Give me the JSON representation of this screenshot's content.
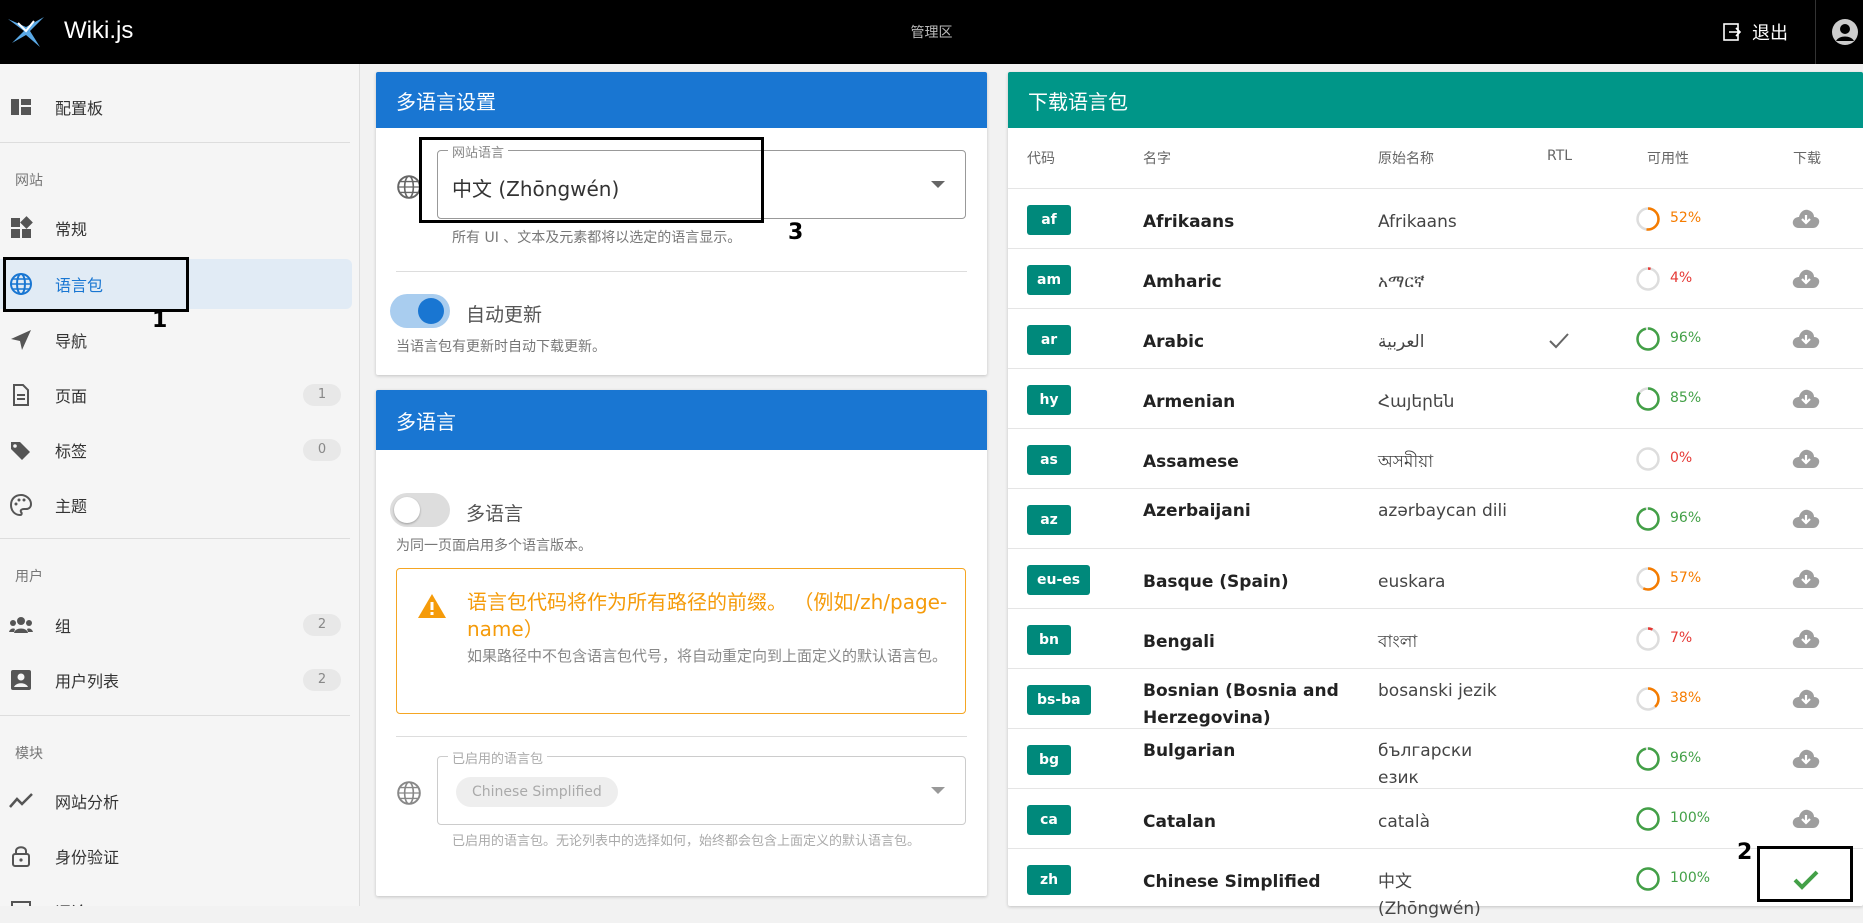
{
  "header": {
    "title": "Wiki.js",
    "center": "管理区",
    "logout": "退出"
  },
  "sidebar": {
    "dashboard": "配置板",
    "section_site": "网站",
    "general": "常规",
    "locale": "语言包",
    "navigation": "导航",
    "pages": "页面",
    "pages_count": "1",
    "tags": "标签",
    "tags_count": "0",
    "theme": "主题",
    "section_users": "用户",
    "groups": "组",
    "groups_count": "2",
    "users": "用户列表",
    "users_count": "2",
    "section_modules": "模块",
    "analytics": "网站分析",
    "auth": "身份验证",
    "comments": "评论"
  },
  "locale_panel": {
    "title": "多语言设置",
    "site_locale_label": "网站语言",
    "site_locale_value": "中文 (Zhōngwén)",
    "site_locale_hint": "所有 UI 、文本及元素都将以选定的语言显示。",
    "auto_update_label": "自动更新",
    "auto_update_hint": "当语言包有更新时自动下载更新。"
  },
  "namespace_panel": {
    "title": "多语言",
    "toggle_label": "多语言",
    "toggle_hint": "为同一页面启用多个语言版本。",
    "warning_title": "语言包代码将作为所有路径的前缀。 （例如/zh/page-name）",
    "warning_sub": "如果路径中不包含语言包代号，将自动重定向到上面定义的默认语言包。",
    "enabled_label": "已启用的语言包",
    "enabled_chip": "Chinese Simplified",
    "enabled_hint": "已启用的语言包。无论列表中的选择如何，始终都会包含上面定义的默认语言包。"
  },
  "download_panel": {
    "title": "下载语言包",
    "columns": {
      "code": "代码",
      "name": "名字",
      "native": "原始名称",
      "rtl": "RTL",
      "availability": "可用性",
      "download": "下载"
    },
    "rows": [
      {
        "code": "af",
        "name": "Afrikaans",
        "native": "Afrikaans",
        "rtl": false,
        "pct": "52%",
        "value": 52,
        "color": "#f57c00",
        "installed": false
      },
      {
        "code": "am",
        "name": "Amharic",
        "native": "አማርኛ",
        "rtl": false,
        "pct": "4%",
        "value": 4,
        "color": "#e53935",
        "installed": false
      },
      {
        "code": "ar",
        "name": "Arabic",
        "native": "العربية",
        "rtl": true,
        "pct": "96%",
        "value": 96,
        "color": "#43a047",
        "installed": false
      },
      {
        "code": "hy",
        "name": "Armenian",
        "native": "Հայերեն",
        "rtl": false,
        "pct": "85%",
        "value": 85,
        "color": "#43a047",
        "installed": false
      },
      {
        "code": "as",
        "name": "Assamese",
        "native": "অসমীয়া",
        "rtl": false,
        "pct": "0%",
        "value": 0,
        "color": "#e53935",
        "installed": false
      },
      {
        "code": "az",
        "name": "Azerbaijani",
        "native": "azərbaycan dili",
        "rtl": false,
        "pct": "96%",
        "value": 96,
        "color": "#43a047",
        "installed": false
      },
      {
        "code": "eu-es",
        "name": "Basque (Spain)",
        "native": "euskara",
        "rtl": false,
        "pct": "57%",
        "value": 57,
        "color": "#f57c00",
        "installed": false
      },
      {
        "code": "bn",
        "name": "Bengali",
        "native": "বাংলা",
        "rtl": false,
        "pct": "7%",
        "value": 7,
        "color": "#e53935",
        "installed": false
      },
      {
        "code": "bs-ba",
        "name": "Bosnian (Bosnia and Herzegovina)",
        "native": "bosanski jezik",
        "rtl": false,
        "pct": "38%",
        "value": 38,
        "color": "#f57c00",
        "installed": false
      },
      {
        "code": "bg",
        "name": "Bulgarian",
        "native": "български език",
        "rtl": false,
        "pct": "96%",
        "value": 96,
        "color": "#43a047",
        "installed": false
      },
      {
        "code": "ca",
        "name": "Catalan",
        "native": "català",
        "rtl": false,
        "pct": "100%",
        "value": 100,
        "color": "#43a047",
        "installed": false
      },
      {
        "code": "zh",
        "name": "Chinese Simplified",
        "native": "中文 (Zhōngwén)",
        "rtl": false,
        "pct": "100%",
        "value": 100,
        "color": "#43a047",
        "installed": true
      }
    ]
  },
  "annotations": {
    "a1": "1",
    "a2": "2",
    "a3": "3"
  }
}
